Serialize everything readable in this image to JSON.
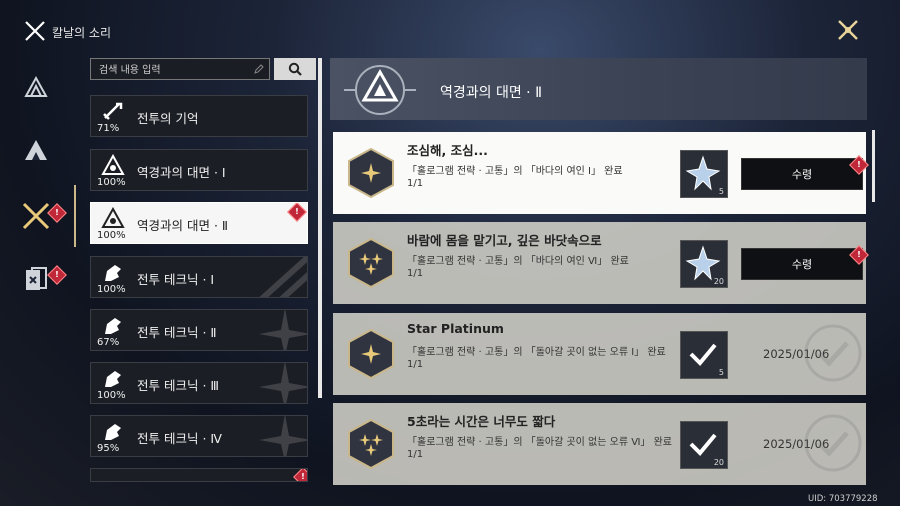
{
  "header": {
    "title": "칼날의 소리"
  },
  "search": {
    "placeholder": "검색 내용 입력"
  },
  "categories": [
    {
      "label": "전투의 기억",
      "percent": "71%",
      "selected": false,
      "badge": false
    },
    {
      "label": "역경과의 대면 · Ⅰ",
      "percent": "100%",
      "selected": false,
      "badge": false
    },
    {
      "label": "역경과의 대면 · Ⅱ",
      "percent": "100%",
      "selected": true,
      "badge": true
    },
    {
      "label": "전투 테크닉 · Ⅰ",
      "percent": "100%",
      "selected": false,
      "badge": false
    },
    {
      "label": "전투 테크닉 · Ⅱ",
      "percent": "67%",
      "selected": false,
      "badge": false
    },
    {
      "label": "전투 테크닉 · Ⅲ",
      "percent": "100%",
      "selected": false,
      "badge": false
    },
    {
      "label": "전투 테크닉 · Ⅳ",
      "percent": "95%",
      "selected": false,
      "badge": false
    }
  ],
  "banner": {
    "title": "역경과의 대면 · Ⅱ"
  },
  "missions": [
    {
      "title": "조심해, 조심...",
      "desc": "「홀로그램 전략 · 고통」의 「바다의 여인 Ⅰ」 완료",
      "progress": "1/1",
      "stars": 1,
      "reward_qty": "5",
      "status": "claim",
      "claim_label": "수령"
    },
    {
      "title": "바람에 몸을 맡기고, 깊은 바닷속으로",
      "desc": "「홀로그램 전략 · 고통」의 「바다의 여인 Ⅵ」 완료",
      "progress": "1/1",
      "stars": 3,
      "reward_qty": "20",
      "status": "claim",
      "claim_label": "수령"
    },
    {
      "title": "Star Platinum",
      "desc": "「홀로그램 전략 · 고통」의 「돌아갈 곳이 없는 오류 Ⅰ」 완료",
      "progress": "1/1",
      "stars": 1,
      "reward_qty": "5",
      "status": "done",
      "date": "2025/01/06"
    },
    {
      "title": "5초라는 시간은 너무도 짧다",
      "desc": "「홀로그램 전략 · 고통」의 「돌아갈 곳이 없는 오류 Ⅵ」 완료",
      "progress": "1/1",
      "stars": 3,
      "reward_qty": "20",
      "status": "done",
      "date": "2025/01/06"
    }
  ],
  "footer": {
    "uid": "UID: 703779228"
  },
  "colors": {
    "accent": "#cbb98a",
    "badge": "#c0283a",
    "gold": "#e8c97a"
  }
}
